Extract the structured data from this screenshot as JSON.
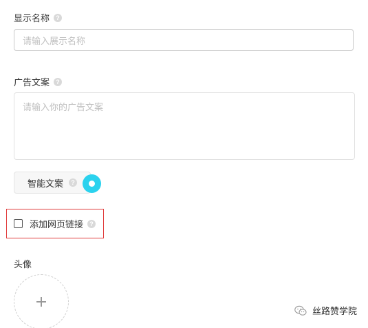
{
  "display_name": {
    "label": "显示名称",
    "placeholder": "请输入展示名称"
  },
  "ad_copy": {
    "label": "广告文案",
    "placeholder": "请输入你的广告文案"
  },
  "smart_copy_button": {
    "label": "智能文案"
  },
  "web_link": {
    "label": "添加网页链接"
  },
  "avatar": {
    "label": "头像",
    "upload_symbol": "+"
  },
  "watermark": {
    "text": "丝路赞学院"
  },
  "help_glyph": "?",
  "colors": {
    "highlight_border": "#e03a3a",
    "cursor": "#2bd2ee",
    "help_icon": "#d9d9d9"
  },
  "icons": {
    "help": "question-circle-icon",
    "plus": "plus-icon",
    "watermark": "wechat-icon"
  }
}
